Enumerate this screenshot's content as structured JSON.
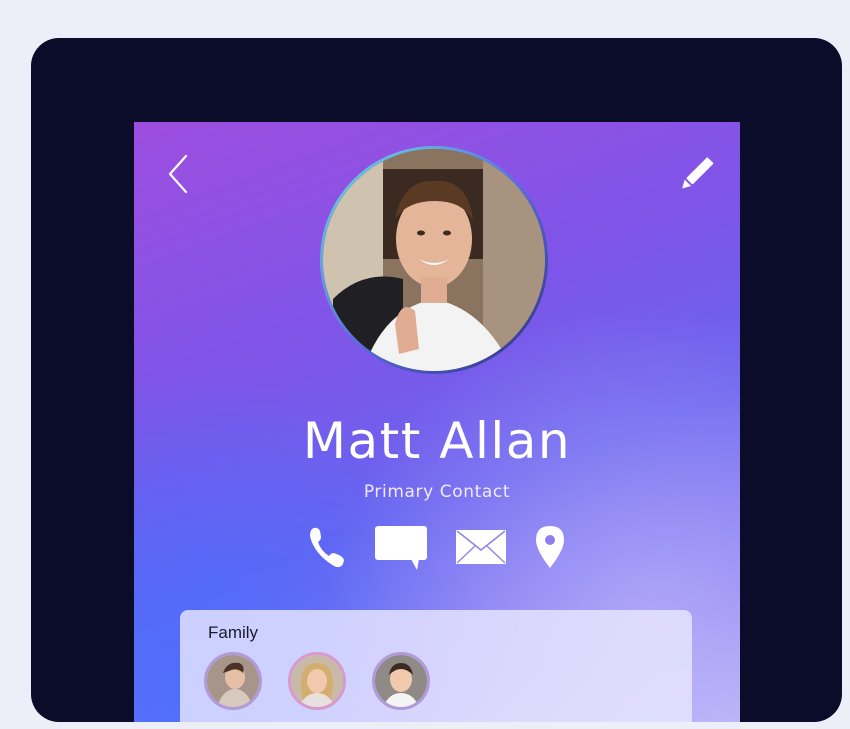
{
  "contact": {
    "name": "Matt Allan",
    "subtitle": "Primary Contact"
  },
  "header": {
    "back_icon": "chevron-left-icon",
    "edit_icon": "pencil-icon"
  },
  "actions": [
    {
      "icon": "phone-icon"
    },
    {
      "icon": "message-icon"
    },
    {
      "icon": "mail-icon"
    },
    {
      "icon": "location-pin-icon"
    }
  ],
  "family": {
    "title": "Family",
    "members": [
      {
        "icon": "avatar-woman"
      },
      {
        "icon": "avatar-girl"
      },
      {
        "icon": "avatar-boy"
      }
    ]
  },
  "colors": {
    "frame": "#0b0b2a",
    "page_background": "#eceff7",
    "gradient_start": "#9d4ee0",
    "gradient_end": "#b1a9f4",
    "card": "#e8e6ff"
  }
}
